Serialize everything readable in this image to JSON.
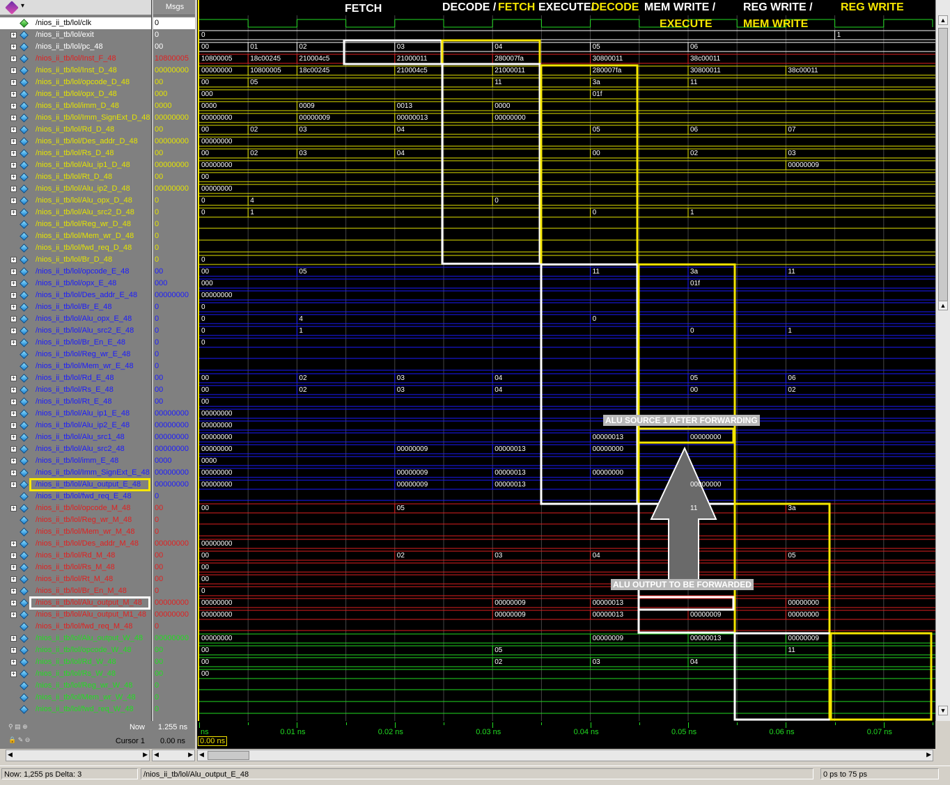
{
  "header": {
    "msgs_label": "Msgs"
  },
  "phases": [
    {
      "text": "FETCH",
      "color": "#ffffff"
    },
    {
      "text": "DECODE / ",
      "color": "#ffffff"
    },
    {
      "text": "FETCH",
      "color": "#f5e600"
    },
    {
      "text": "EXECUTE/",
      "color": "#ffffff"
    },
    {
      "text": "DECODE",
      "color": "#f5e600"
    },
    {
      "text": "MEM WRITE /",
      "color": "#ffffff"
    },
    {
      "text": "EXECUTE",
      "color": "#f5e600"
    },
    {
      "text": "REG WRITE /",
      "color": "#ffffff"
    },
    {
      "text": "MEM WRITE",
      "color": "#f5e600"
    },
    {
      "text": "REG WRITE",
      "color": "#f5e600"
    }
  ],
  "callouts": {
    "alu_src1": "ALU SOURCE 1 AFTER FORWARDING",
    "alu_out": "ALU OUTPUT TO BE FORWARDED"
  },
  "signals": [
    {
      "name": "/nios_ii_tb/lol/clk",
      "value": "0",
      "color": "white",
      "exp": false
    },
    {
      "name": "/nios_ii_tb/lol/exit",
      "value": "0",
      "color": "white",
      "exp": true
    },
    {
      "name": "/nios_ii_tb/lol/pc_48",
      "value": "00",
      "color": "white",
      "exp": true
    },
    {
      "name": "/nios_ii_tb/lol/Inst_F_48",
      "value": "10800005",
      "color": "red",
      "exp": true
    },
    {
      "name": "/nios_ii_tb/lol/Inst_D_48",
      "value": "00000000",
      "color": "yellow",
      "exp": true
    },
    {
      "name": "/nios_ii_tb/lol/opcode_D_48",
      "value": "00",
      "color": "yellow",
      "exp": true
    },
    {
      "name": "/nios_ii_tb/lol/opx_D_48",
      "value": "000",
      "color": "yellow",
      "exp": true
    },
    {
      "name": "/nios_ii_tb/lol/imm_D_48",
      "value": "0000",
      "color": "yellow",
      "exp": true
    },
    {
      "name": "/nios_ii_tb/lol/Imm_SignExt_D_48",
      "value": "00000000",
      "color": "yellow",
      "exp": true
    },
    {
      "name": "/nios_ii_tb/lol/Rd_D_48",
      "value": "00",
      "color": "yellow",
      "exp": true
    },
    {
      "name": "/nios_ii_tb/lol/Des_addr_D_48",
      "value": "00000000",
      "color": "yellow",
      "exp": true
    },
    {
      "name": "/nios_ii_tb/lol/Rs_D_48",
      "value": "00",
      "color": "yellow",
      "exp": true
    },
    {
      "name": "/nios_ii_tb/lol/Alu_ip1_D_48",
      "value": "00000000",
      "color": "yellow",
      "exp": true
    },
    {
      "name": "/nios_ii_tb/lol/Rt_D_48",
      "value": "00",
      "color": "yellow",
      "exp": true
    },
    {
      "name": "/nios_ii_tb/lol/Alu_ip2_D_48",
      "value": "00000000",
      "color": "yellow",
      "exp": true
    },
    {
      "name": "/nios_ii_tb/lol/Alu_opx_D_48",
      "value": "0",
      "color": "yellow",
      "exp": true
    },
    {
      "name": "/nios_ii_tb/lol/Alu_src2_D_48",
      "value": "0",
      "color": "yellow",
      "exp": true
    },
    {
      "name": "/nios_ii_tb/lol/Reg_wr_D_48",
      "value": "0",
      "color": "yellow",
      "exp": false
    },
    {
      "name": "/nios_ii_tb/lol/Mem_wr_D_48",
      "value": "0",
      "color": "yellow",
      "exp": false
    },
    {
      "name": "/nios_ii_tb/lol/fwd_req_D_48",
      "value": "0",
      "color": "yellow",
      "exp": false
    },
    {
      "name": "/nios_ii_tb/lol/Br_D_48",
      "value": "0",
      "color": "yellow",
      "exp": true
    },
    {
      "name": "/nios_ii_tb/lol/opcode_E_48",
      "value": "00",
      "color": "blue",
      "exp": true
    },
    {
      "name": "/nios_ii_tb/lol/opx_E_48",
      "value": "000",
      "color": "blue",
      "exp": true
    },
    {
      "name": "/nios_ii_tb/lol/Des_addr_E_48",
      "value": "00000000",
      "color": "blue",
      "exp": true
    },
    {
      "name": "/nios_ii_tb/lol/Br_E_48",
      "value": "0",
      "color": "blue",
      "exp": true
    },
    {
      "name": "/nios_ii_tb/lol/Alu_opx_E_48",
      "value": "0",
      "color": "blue",
      "exp": true
    },
    {
      "name": "/nios_ii_tb/lol/Alu_src2_E_48",
      "value": "0",
      "color": "blue",
      "exp": true
    },
    {
      "name": "/nios_ii_tb/lol/Br_En_E_48",
      "value": "0",
      "color": "blue",
      "exp": true
    },
    {
      "name": "/nios_ii_tb/lol/Reg_wr_E_48",
      "value": "0",
      "color": "blue",
      "exp": false
    },
    {
      "name": "/nios_ii_tb/lol/Mem_wr_E_48",
      "value": "0",
      "color": "blue",
      "exp": false
    },
    {
      "name": "/nios_ii_tb/lol/Rd_E_48",
      "value": "00",
      "color": "blue",
      "exp": true
    },
    {
      "name": "/nios_ii_tb/lol/Rs_E_48",
      "value": "00",
      "color": "blue",
      "exp": true
    },
    {
      "name": "/nios_ii_tb/lol/Rt_E_48",
      "value": "00",
      "color": "blue",
      "exp": true
    },
    {
      "name": "/nios_ii_tb/lol/Alu_ip1_E_48",
      "value": "00000000",
      "color": "blue",
      "exp": true
    },
    {
      "name": "/nios_ii_tb/lol/Alu_ip2_E_48",
      "value": "00000000",
      "color": "blue",
      "exp": true
    },
    {
      "name": "/nios_ii_tb/lol/Alu_src1_48",
      "value": "00000000",
      "color": "blue",
      "exp": true
    },
    {
      "name": "/nios_ii_tb/lol/Alu_src2_48",
      "value": "00000000",
      "color": "blue",
      "exp": true
    },
    {
      "name": "/nios_ii_tb/lol/imm_E_48",
      "value": "0000",
      "color": "blue",
      "exp": true
    },
    {
      "name": "/nios_ii_tb/lol/Imm_SignExt_E_48",
      "value": "00000000",
      "color": "blue",
      "exp": true
    },
    {
      "name": "/nios_ii_tb/lol/Alu_output_E_48",
      "value": "00000000",
      "color": "blue",
      "exp": true
    },
    {
      "name": "/nios_ii_tb/lol/fwd_req_E_48",
      "value": "0",
      "color": "blue",
      "exp": false
    },
    {
      "name": "/nios_ii_tb/lol/opcode_M_48",
      "value": "00",
      "color": "red",
      "exp": true
    },
    {
      "name": "/nios_ii_tb/lol/Reg_wr_M_48",
      "value": "0",
      "color": "red",
      "exp": false
    },
    {
      "name": "/nios_ii_tb/lol/Mem_wr_M_48",
      "value": "0",
      "color": "red",
      "exp": false
    },
    {
      "name": "/nios_ii_tb/lol/Des_addr_M_48",
      "value": "00000000",
      "color": "red",
      "exp": true
    },
    {
      "name": "/nios_ii_tb/lol/Rd_M_48",
      "value": "00",
      "color": "red",
      "exp": true
    },
    {
      "name": "/nios_ii_tb/lol/Rs_M_48",
      "value": "00",
      "color": "red",
      "exp": true
    },
    {
      "name": "/nios_ii_tb/lol/Rt_M_48",
      "value": "00",
      "color": "red",
      "exp": true
    },
    {
      "name": "/nios_ii_tb/lol/Br_En_M_48",
      "value": "0",
      "color": "red",
      "exp": true
    },
    {
      "name": "/nios_ii_tb/lol/Alu_output_M_48",
      "value": "00000000",
      "color": "red",
      "exp": true
    },
    {
      "name": "/nios_ii_tb/lol/Alu_output_M1_48",
      "value": "00000000",
      "color": "red",
      "exp": true
    },
    {
      "name": "/nios_ii_tb/lol/fwd_req_M_48",
      "value": "0",
      "color": "red",
      "exp": false
    },
    {
      "name": "/nios_ii_tb/lol/Alu_output_W_48",
      "value": "00000000",
      "color": "green",
      "exp": true
    },
    {
      "name": "/nios_ii_tb/lol/opcode_W_48",
      "value": "00",
      "color": "green",
      "exp": true
    },
    {
      "name": "/nios_ii_tb/lol/Rd_W_48",
      "value": "00",
      "color": "green",
      "exp": true
    },
    {
      "name": "/nios_ii_tb/lol/Rs_W_48",
      "value": "00",
      "color": "green",
      "exp": true
    },
    {
      "name": "/nios_ii_tb/lol/Reg_wr_W_48",
      "value": "0",
      "color": "green",
      "exp": false
    },
    {
      "name": "/nios_ii_tb/lol/Mem_wr_W_48",
      "value": "0",
      "color": "green",
      "exp": false
    },
    {
      "name": "/nios_ii_tb/lol/fwd_req_W_48",
      "value": "0",
      "color": "green",
      "exp": false
    }
  ],
  "wave_values": [
    {
      "row": 1,
      "vals": [
        "0",
        "",
        "",
        "",
        "",
        "",
        "",
        "",
        "",
        "",
        "",
        "",
        "",
        "1"
      ]
    },
    {
      "row": 2,
      "vals": [
        "00",
        "01",
        "02",
        "",
        "03",
        "",
        "04",
        "",
        "05",
        "",
        "06",
        "",
        ""
      ]
    },
    {
      "row": 3,
      "vals": [
        "10800005",
        "18c00245",
        "210004c5",
        "",
        "21000011",
        "",
        "280007fa",
        "",
        "30800011",
        "",
        "38c00011",
        "",
        ""
      ]
    },
    {
      "row": 4,
      "vals": [
        "00000000",
        "10800005",
        "18c00245",
        "",
        "210004c5",
        "",
        "21000011",
        "",
        "280007fa",
        "",
        "30800011",
        "",
        "38c00011"
      ]
    },
    {
      "row": 5,
      "vals": [
        "00",
        "05",
        "",
        "",
        "",
        "",
        "11",
        "",
        "3a",
        "",
        "11",
        "",
        ""
      ]
    },
    {
      "row": 6,
      "vals": [
        "000",
        "",
        "",
        "",
        "",
        "",
        "",
        "",
        "01f",
        "",
        "",
        "",
        ""
      ]
    },
    {
      "row": 7,
      "vals": [
        "0000",
        "",
        "0009",
        "",
        "0013",
        "",
        "0000",
        "",
        "",
        "",
        "",
        "",
        ""
      ]
    },
    {
      "row": 8,
      "vals": [
        "00000000",
        "",
        "00000009",
        "",
        "00000013",
        "",
        "00000000",
        "",
        "",
        "",
        "",
        "",
        ""
      ]
    },
    {
      "row": 9,
      "vals": [
        "00",
        "02",
        "03",
        "",
        "04",
        "",
        "",
        "",
        "05",
        "",
        "06",
        "",
        "07"
      ]
    },
    {
      "row": 10,
      "vals": [
        "00000000",
        "",
        "",
        "",
        "",
        "",
        "",
        "",
        "",
        "",
        "",
        "",
        ""
      ]
    },
    {
      "row": 11,
      "vals": [
        "00",
        "02",
        "03",
        "",
        "04",
        "",
        "",
        "",
        "00",
        "",
        "02",
        "",
        "03"
      ]
    },
    {
      "row": 12,
      "vals": [
        "00000000",
        "",
        "",
        "",
        "",
        "",
        "",
        "",
        "",
        "",
        "",
        "",
        "00000009"
      ]
    },
    {
      "row": 13,
      "vals": [
        "00",
        "",
        "",
        "",
        "",
        "",
        "",
        "",
        "",
        "",
        "",
        "",
        ""
      ]
    },
    {
      "row": 14,
      "vals": [
        "00000000",
        "",
        "",
        "",
        "",
        "",
        "",
        "",
        "",
        "",
        "",
        "",
        ""
      ]
    },
    {
      "row": 15,
      "vals": [
        "0",
        "4",
        "",
        "",
        "",
        "",
        "0",
        "",
        "",
        "",
        "",
        "",
        ""
      ]
    },
    {
      "row": 16,
      "vals": [
        "0",
        "1",
        "",
        "",
        "",
        "",
        "",
        "",
        "0",
        "",
        "1",
        "",
        ""
      ]
    },
    {
      "row": 20,
      "vals": [
        "0",
        "",
        "",
        "",
        "",
        "",
        "",
        "",
        "",
        "",
        "",
        "",
        ""
      ]
    },
    {
      "row": 21,
      "vals": [
        "00",
        "",
        "05",
        "",
        "",
        "",
        "",
        "",
        "11",
        "",
        "3a",
        "",
        "11"
      ]
    },
    {
      "row": 22,
      "vals": [
        "000",
        "",
        "",
        "",
        "",
        "",
        "",
        "",
        "",
        "",
        "01f",
        "",
        ""
      ]
    },
    {
      "row": 23,
      "vals": [
        "00000000",
        "",
        "",
        "",
        "",
        "",
        "",
        "",
        "",
        "",
        "",
        "",
        ""
      ]
    },
    {
      "row": 24,
      "vals": [
        "0",
        "",
        "",
        "",
        "",
        "",
        "",
        "",
        "",
        "",
        "",
        "",
        ""
      ]
    },
    {
      "row": 25,
      "vals": [
        "0",
        "",
        "4",
        "",
        "",
        "",
        "",
        "",
        "0",
        "",
        "",
        "",
        ""
      ]
    },
    {
      "row": 26,
      "vals": [
        "0",
        "",
        "1",
        "",
        "",
        "",
        "",
        "",
        "",
        "",
        "0",
        "",
        "1"
      ]
    },
    {
      "row": 27,
      "vals": [
        "0",
        "",
        "",
        "",
        "",
        "",
        "",
        "",
        "",
        "",
        "",
        "",
        ""
      ]
    },
    {
      "row": 30,
      "vals": [
        "00",
        "",
        "02",
        "",
        "03",
        "",
        "04",
        "",
        "",
        "",
        "05",
        "",
        "06"
      ]
    },
    {
      "row": 31,
      "vals": [
        "00",
        "",
        "02",
        "",
        "03",
        "",
        "04",
        "",
        "",
        "",
        "00",
        "",
        "02"
      ]
    },
    {
      "row": 32,
      "vals": [
        "00",
        "",
        "",
        "",
        "",
        "",
        "",
        "",
        "",
        "",
        "",
        "",
        ""
      ]
    },
    {
      "row": 33,
      "vals": [
        "00000000",
        "",
        "",
        "",
        "",
        "",
        "",
        "",
        "",
        "",
        "",
        "",
        ""
      ]
    },
    {
      "row": 34,
      "vals": [
        "00000000",
        "",
        "",
        "",
        "",
        "",
        "",
        "",
        "",
        "",
        "",
        "",
        ""
      ]
    },
    {
      "row": 35,
      "vals": [
        "00000000",
        "",
        "",
        "",
        "",
        "",
        "",
        "",
        "00000013",
        "",
        "00000000",
        "",
        ""
      ]
    },
    {
      "row": 36,
      "vals": [
        "00000000",
        "",
        "",
        "",
        "00000009",
        "",
        "00000013",
        "",
        "00000000",
        "",
        "",
        "",
        ""
      ]
    },
    {
      "row": 37,
      "vals": [
        "0000",
        "",
        "",
        "",
        "",
        "",
        "",
        "",
        "",
        "",
        "",
        "",
        ""
      ]
    },
    {
      "row": 38,
      "vals": [
        "00000000",
        "",
        "",
        "",
        "00000009",
        "",
        "00000013",
        "",
        "00000000",
        "",
        "",
        "",
        ""
      ]
    },
    {
      "row": 39,
      "vals": [
        "00000000",
        "",
        "",
        "",
        "00000009",
        "",
        "00000013",
        "",
        "",
        "",
        "00000000",
        "",
        ""
      ]
    },
    {
      "row": 41,
      "vals": [
        "00",
        "",
        "",
        "",
        "05",
        "",
        "",
        "",
        "",
        "",
        "11",
        "",
        "3a"
      ]
    },
    {
      "row": 44,
      "vals": [
        "00000000",
        "",
        "",
        "",
        "",
        "",
        "",
        "",
        "",
        "",
        "",
        "",
        ""
      ]
    },
    {
      "row": 45,
      "vals": [
        "00",
        "",
        "",
        "",
        "02",
        "",
        "03",
        "",
        "04",
        "",
        "",
        "",
        "05"
      ]
    },
    {
      "row": 46,
      "vals": [
        "00",
        "",
        "",
        "",
        "",
        "",
        "",
        "",
        "",
        "",
        "",
        "",
        ""
      ]
    },
    {
      "row": 47,
      "vals": [
        "00",
        "",
        "",
        "",
        "",
        "",
        "",
        "",
        "",
        "",
        "",
        "",
        ""
      ]
    },
    {
      "row": 48,
      "vals": [
        "0",
        "",
        "",
        "",
        "",
        "",
        "",
        "",
        "",
        "",
        "",
        "",
        ""
      ]
    },
    {
      "row": 49,
      "vals": [
        "00000000",
        "",
        "",
        "",
        "",
        "",
        "00000009",
        "",
        "00000013",
        "",
        "",
        "",
        "00000000"
      ]
    },
    {
      "row": 50,
      "vals": [
        "00000000",
        "",
        "",
        "",
        "",
        "",
        "00000009",
        "",
        "00000013",
        "",
        "00000009",
        "",
        "00000000"
      ]
    },
    {
      "row": 52,
      "vals": [
        "00000000",
        "",
        "",
        "",
        "",
        "",
        "",
        "",
        "00000009",
        "",
        "00000013",
        "",
        "00000009"
      ]
    },
    {
      "row": 53,
      "vals": [
        "00",
        "",
        "",
        "",
        "",
        "",
        "05",
        "",
        "",
        "",
        "",
        "",
        "11"
      ]
    },
    {
      "row": 54,
      "vals": [
        "00",
        "",
        "",
        "",
        "",
        "",
        "02",
        "",
        "03",
        "",
        "04",
        "",
        ""
      ]
    },
    {
      "row": 55,
      "vals": [
        "00",
        "",
        "",
        "",
        "",
        "",
        "",
        "",
        "",
        "",
        "",
        "",
        ""
      ]
    }
  ],
  "bottom": {
    "now_label": "Now",
    "now_value": "1.255 ns",
    "cursor_label": "Cursor 1",
    "cursor_value": "0.00 ns",
    "cursor_marker": "0.00 ns",
    "time_labels": [
      "ns",
      "0.01 ns",
      "0.02 ns",
      "0.03 ns",
      "0.04 ns",
      "0.05 ns",
      "0.06 ns",
      "0.07 ns"
    ]
  },
  "status": {
    "now": "Now: 1,255 ps  Delta: 3",
    "selected": "/nios_ii_tb/lol/Alu_output_E_48",
    "range": "0 ps to 75 ps"
  },
  "colors": {
    "white": "#ffffff",
    "yellow": "#e4e400",
    "blue": "#1a1aff",
    "red": "#e02020",
    "green": "#22dd22",
    "highlight": "#f5e600"
  }
}
